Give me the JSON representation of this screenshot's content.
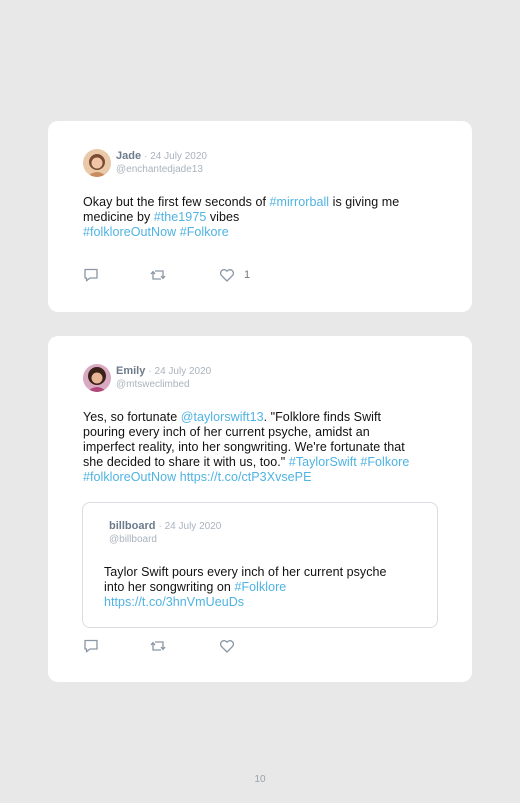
{
  "tweets": [
    {
      "name": "Jade",
      "date": "· 24 July 2020",
      "handle": "@enchantedjade13",
      "text": [
        {
          "t": "Okay but the first few seconds of ",
          "tag": false
        },
        {
          "t": "#mirrorball",
          "tag": true
        },
        {
          "t": " is giving me",
          "tag": false
        },
        {
          "t": "\nmedicine by ",
          "tag": false
        },
        {
          "t": "#the1975",
          "tag": true
        },
        {
          "t": " vibes",
          "tag": false
        },
        {
          "t": "\n",
          "tag": false
        },
        {
          "t": "#folkloreOutNow",
          "tag": true
        },
        {
          "t": " ",
          "tag": false
        },
        {
          "t": "#Folkore",
          "tag": true
        }
      ],
      "likes": "1"
    },
    {
      "name": "Emily",
      "date": "· 24 July 2020",
      "handle": "@mtsweclimbed",
      "text": [
        {
          "t": "Yes, so fortunate ",
          "tag": false
        },
        {
          "t": "@taylorswift13",
          "tag": true
        },
        {
          "t": ". \"Folklore finds Swift",
          "tag": false
        },
        {
          "t": "\npouring every inch of her current psyche, amidst an",
          "tag": false
        },
        {
          "t": "\nimperfect reality, into her songwriting. We're fortunate that",
          "tag": false
        },
        {
          "t": "\nshe decided to share it with us, too.\" ",
          "tag": false
        },
        {
          "t": "#TaylorSwift",
          "tag": true
        },
        {
          "t": " ",
          "tag": false
        },
        {
          "t": "#Folkore",
          "tag": true
        },
        {
          "t": "\n",
          "tag": false
        },
        {
          "t": "#folkloreOutNow",
          "tag": true
        },
        {
          "t": " ",
          "tag": false
        },
        {
          "t": "https://t.co/ctP3XvsePE",
          "tag": true
        }
      ],
      "quote": {
        "name": "billboard",
        "date": "· 24 July 2020",
        "handle": "@billboard",
        "text": [
          {
            "t": "Taylor Swift pours every inch of her current psyche",
            "tag": false
          },
          {
            "t": "\ninto her songwriting on ",
            "tag": false
          },
          {
            "t": "#Folklore",
            "tag": true
          },
          {
            "t": "\n",
            "tag": false
          },
          {
            "t": "https://t.co/3hnVmUeuDs",
            "tag": true
          }
        ]
      }
    }
  ],
  "page_number": "10",
  "colors": {
    "link": "#4fb3e3",
    "name": "#6c7a8a",
    "meta": "#a9b3bd",
    "background": "#e8e8e8",
    "card": "#ffffff"
  },
  "icons": [
    "reply-icon",
    "retweet-icon",
    "like-icon"
  ]
}
